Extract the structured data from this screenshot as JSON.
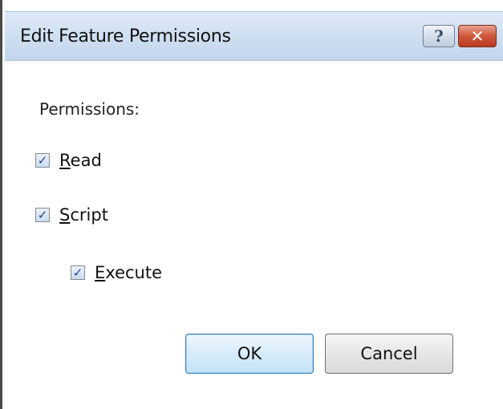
{
  "dialog": {
    "title": "Edit Feature Permissions",
    "help_glyph": "?",
    "close_glyph": "✕"
  },
  "permissions": {
    "label": "Permissions:",
    "items": [
      {
        "mnemonic": "R",
        "rest": "ead",
        "checked": true
      },
      {
        "mnemonic": "S",
        "rest": "cript",
        "checked": true
      },
      {
        "mnemonic": "E",
        "rest": "xecute",
        "checked": true
      }
    ]
  },
  "buttons": {
    "ok_label": "OK",
    "cancel_label": "Cancel"
  },
  "check_glyph": "✓"
}
